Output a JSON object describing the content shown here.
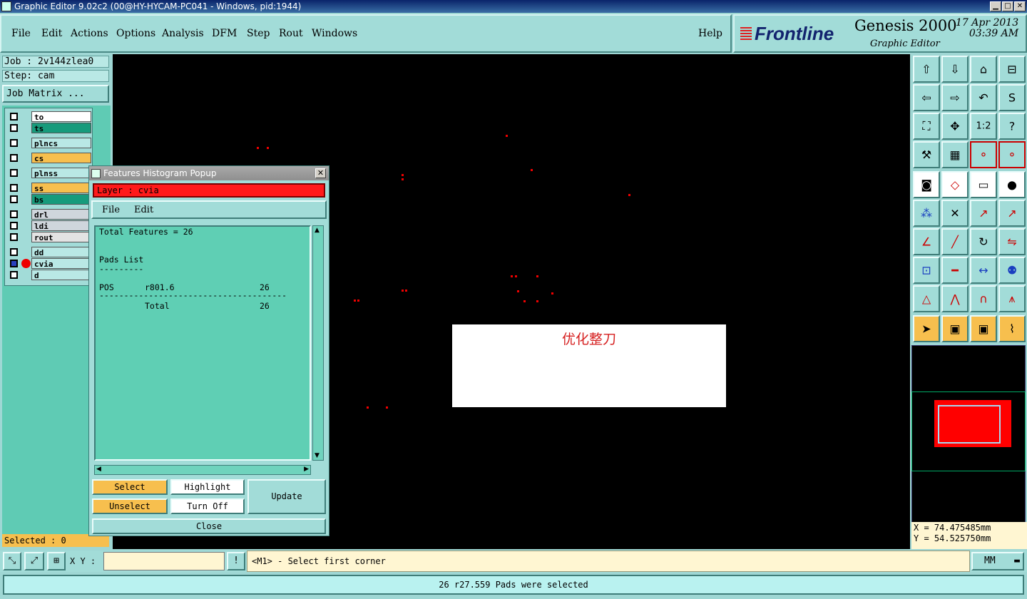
{
  "window": {
    "title": "Graphic Editor 9.02c2 (00@HY-HYCAM-PC041 - Windows, pid:1944)"
  },
  "menu": [
    "File",
    "Edit",
    "Actions",
    "Options",
    "Analysis",
    "DFM",
    "Step",
    "Rout",
    "Windows"
  ],
  "help": "Help",
  "brand": {
    "logo": "Frontline",
    "product": "Genesis 2000",
    "subtitle": "Graphic Editor",
    "date": "17 Apr 2013",
    "time": "03:39 AM"
  },
  "job": {
    "job_label": "Job : 2v144zlea0",
    "step_label": "Step: cam",
    "matrix_button": "Job Matrix ..."
  },
  "layers": [
    {
      "name": "to",
      "color": "#ffffff"
    },
    {
      "name": "ts",
      "color": "#179b7c"
    },
    {
      "name": "plncs",
      "color": "#b9e8e5"
    },
    {
      "name": "cs",
      "color": "#f7bf4e"
    },
    {
      "name": "plnss",
      "color": "#b9e8e5"
    },
    {
      "name": "ss",
      "color": "#f7bf4e"
    },
    {
      "name": "bs",
      "color": "#179b7c"
    },
    {
      "name": "drl",
      "color": "#cfd6dc"
    },
    {
      "name": "ldi",
      "color": "#cfd6dc"
    },
    {
      "name": "rout",
      "color": "#e3e3e3"
    },
    {
      "name": "dd",
      "color": "#b9e8e5"
    },
    {
      "name": "cvia",
      "color": "#b9e8e5",
      "active": true
    },
    {
      "name": "d",
      "color": "#b9e8e5"
    }
  ],
  "selected_label": "Selected : 0",
  "canvas": {
    "note": "优化整刀"
  },
  "popup": {
    "title": "Features Histogram Popup",
    "layer_label": "Layer :  cvia",
    "menu": [
      "File",
      "Edit"
    ],
    "text": {
      "total": "Total Features = 26",
      "list_title": "Pads List",
      "underline": "---------",
      "row_type": "POS",
      "row_symbol": "r801.6",
      "row_count": "26",
      "dashes": "--------------------------------------",
      "total_label": "Total",
      "total_count": "26"
    },
    "buttons": {
      "select": "Select",
      "highlight": "Highlight",
      "update": "Update",
      "unselect": "Unselect",
      "turnoff": "Turn Off",
      "close": "Close"
    }
  },
  "coords": {
    "x": "X = 74.475485mm",
    "y": "Y = 54.525750mm"
  },
  "bottom": {
    "xy_label": "X Y :",
    "xy_value": "",
    "prompt": "<M1> - Select first corner",
    "units": "MM"
  },
  "status": "26 r27.559 Pads were selected"
}
